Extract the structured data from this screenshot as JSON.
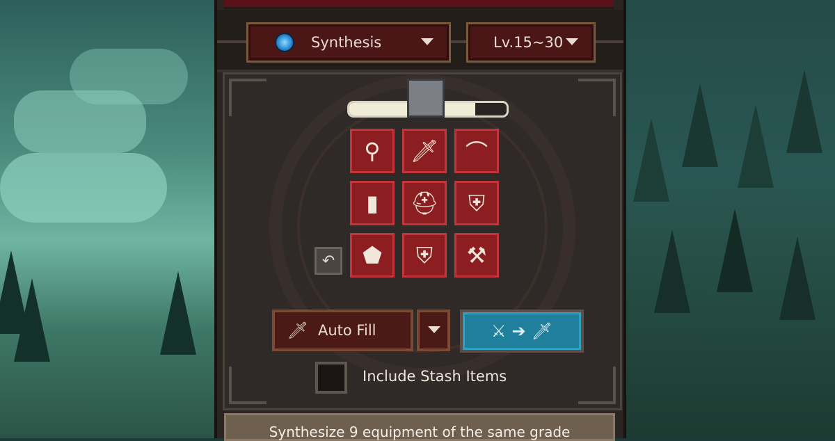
{
  "header": {
    "synthesis_dropdown": {
      "label": "Synthesis",
      "icon": "blue-gem-icon"
    },
    "level_dropdown": {
      "label": "Lv.15~30"
    }
  },
  "progress": {
    "value": 0.8
  },
  "grid": {
    "slots": [
      {
        "icon": "mace-icon",
        "glyph": "⚲"
      },
      {
        "icon": "frost-sword-icon",
        "glyph": "🗡"
      },
      {
        "icon": "bow-icon",
        "glyph": "⌒"
      },
      {
        "icon": "spellbook-icon",
        "glyph": "▮"
      },
      {
        "icon": "helmet-icon",
        "glyph": "⛑"
      },
      {
        "icon": "armor-icon",
        "glyph": "⛨"
      },
      {
        "icon": "shield-icon",
        "glyph": "⬟"
      },
      {
        "icon": "chest-armor-icon",
        "glyph": "⛨"
      },
      {
        "icon": "axe-icon",
        "glyph": "⚒"
      }
    ]
  },
  "buttons": {
    "undo": {
      "icon": "undo-icon",
      "glyph": "↶"
    },
    "auto_fill": {
      "label": "Auto Fill",
      "icon": "sword-icon"
    },
    "synthesize": {
      "icon": "synthesize-icon",
      "glyph_left": "⚔",
      "glyph_arrow": "➔",
      "glyph_right": "🗡"
    }
  },
  "stash": {
    "label": "Include Stash Items",
    "checked": false
  },
  "footer": {
    "text": "Synthesize 9 equipment of the same grade"
  }
}
